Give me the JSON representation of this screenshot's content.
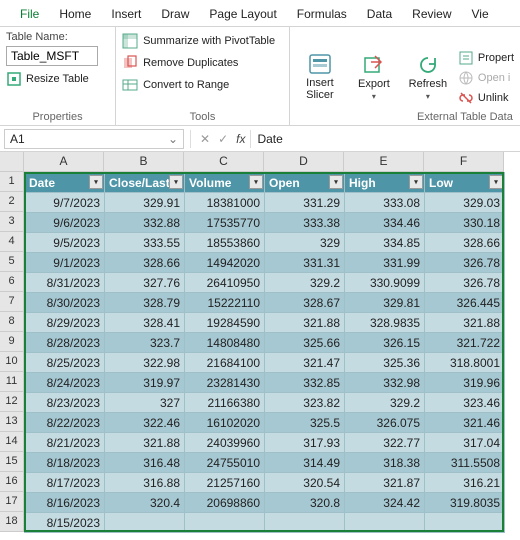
{
  "tabs": [
    "File",
    "Home",
    "Insert",
    "Draw",
    "Page Layout",
    "Formulas",
    "Data",
    "Review",
    "Vie"
  ],
  "ribbon": {
    "group1": {
      "title": "Properties",
      "table_name_label": "Table Name:",
      "table_name_value": "Table_MSFT",
      "resize": "Resize Table"
    },
    "group2": {
      "title": "Tools",
      "pivot": "Summarize with PivotTable",
      "dup": "Remove Duplicates",
      "convert": "Convert to Range"
    },
    "group3": {
      "title": "External Table Data",
      "slicer": "Insert\nSlicer",
      "export": "Export",
      "refresh": "Refresh",
      "properties": "Propert",
      "open": "Open i",
      "unlink": "Unlink"
    }
  },
  "fbar": {
    "namebox": "A1",
    "formula": "Date"
  },
  "columns": [
    "A",
    "B",
    "C",
    "D",
    "E",
    "F"
  ],
  "headers": [
    "Date",
    "Close/Last",
    "Volume",
    "Open",
    "High",
    "Low"
  ],
  "row_start": 1,
  "rows": [
    [
      "9/7/2023",
      "329.91",
      "18381000",
      "331.29",
      "333.08",
      "329.03"
    ],
    [
      "9/6/2023",
      "332.88",
      "17535770",
      "333.38",
      "334.46",
      "330.18"
    ],
    [
      "9/5/2023",
      "333.55",
      "18553860",
      "329",
      "334.85",
      "328.66"
    ],
    [
      "9/1/2023",
      "328.66",
      "14942020",
      "331.31",
      "331.99",
      "326.78"
    ],
    [
      "8/31/2023",
      "327.76",
      "26410950",
      "329.2",
      "330.9099",
      "326.78"
    ],
    [
      "8/30/2023",
      "328.79",
      "15222110",
      "328.67",
      "329.81",
      "326.445"
    ],
    [
      "8/29/2023",
      "328.41",
      "19284590",
      "321.88",
      "328.9835",
      "321.88"
    ],
    [
      "8/28/2023",
      "323.7",
      "14808480",
      "325.66",
      "326.15",
      "321.722"
    ],
    [
      "8/25/2023",
      "322.98",
      "21684100",
      "321.47",
      "325.36",
      "318.8001"
    ],
    [
      "8/24/2023",
      "319.97",
      "23281430",
      "332.85",
      "332.98",
      "319.96"
    ],
    [
      "8/23/2023",
      "327",
      "21166380",
      "323.82",
      "329.2",
      "323.46"
    ],
    [
      "8/22/2023",
      "322.46",
      "16102020",
      "325.5",
      "326.075",
      "321.46"
    ],
    [
      "8/21/2023",
      "321.88",
      "24039960",
      "317.93",
      "322.77",
      "317.04"
    ],
    [
      "8/18/2023",
      "316.48",
      "24755010",
      "314.49",
      "318.38",
      "311.5508"
    ],
    [
      "8/17/2023",
      "316.88",
      "21257160",
      "320.54",
      "321.87",
      "316.21"
    ],
    [
      "8/16/2023",
      "320.4",
      "20698860",
      "320.8",
      "324.42",
      "319.8035"
    ],
    [
      "8/15/2023",
      "",
      "",
      "",
      "",
      ""
    ]
  ]
}
